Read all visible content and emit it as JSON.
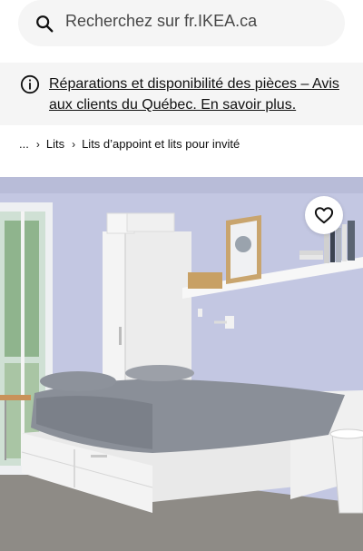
{
  "search": {
    "placeholder": "Recherchez sur fr.IKEA.ca",
    "icon": "search-icon"
  },
  "notice": {
    "icon": "info-icon",
    "link_text": "Réparations et disponibilité des pièces – Avis aux clients du Québec. En savoir plus."
  },
  "breadcrumb": {
    "items": [
      "...",
      "Lits",
      "Lits d’appoint et lits pour invité"
    ],
    "separator_icon": "chevron-right-icon"
  },
  "product_image": {
    "subject": "bedroom-photo",
    "favorite_icon": "heart-icon"
  },
  "colors": {
    "search_bg": "#f5f5f5",
    "notice_bg": "#f5f5f5",
    "wall": "#bfc3dc"
  }
}
